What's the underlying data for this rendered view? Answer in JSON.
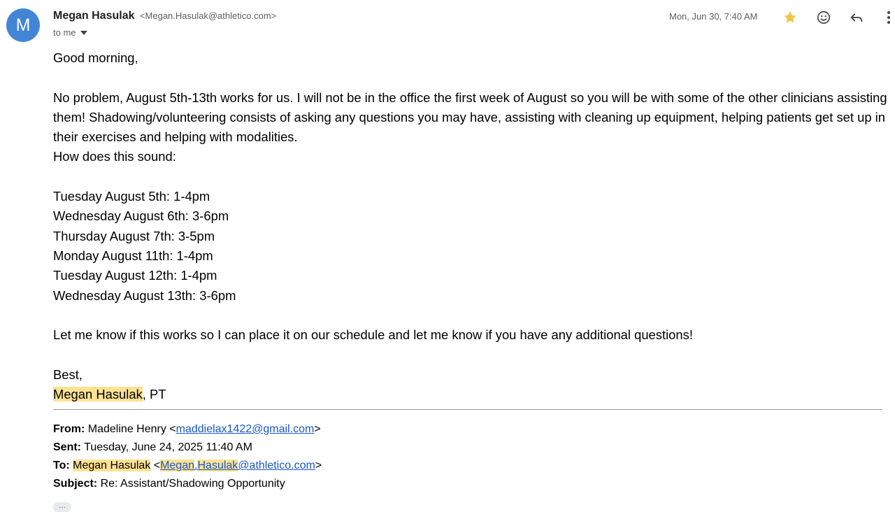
{
  "sender": {
    "initial": "M",
    "name": "Megan Hasulak",
    "email": "<Megan.Hasulak@athletico.com>",
    "to": "to me",
    "date": "Mon, Jun 30, 7:40 AM"
  },
  "header_icons": {
    "star": "star-icon",
    "emoji": "emoji-icon",
    "reply": "reply-icon",
    "more": "more-vertical-icon",
    "star_color": "#f6c343"
  },
  "body": {
    "greeting": "Good morning,",
    "para1": "No problem, August 5th-13th works for us. I will not be in the office the first week of August so you will be with some of the other clinicians assisting them! Shadowing/volunteering consists of asking any questions you may have, assisting with cleaning up equipment, helping patients get set up in their exercises and helping with modalities.",
    "question": "How does this sound:",
    "schedule": [
      "Tuesday August 5th: 1-4pm",
      "Wednesday August 6th: 3-6pm",
      "Thursday August 7th: 3-5pm",
      "Monday August 11th: 1-4pm",
      "Tuesday August 12th: 1-4pm",
      "Wednesday August 13th: 3-6pm"
    ],
    "closing": "Let me know if this works so I can place it on our schedule and let me know if you have any additional questions!",
    "signoff": "Best,",
    "signature_name": "Megan Hasulak",
    "signature_suffix": ", PT"
  },
  "quoted": {
    "from_label": "From:",
    "from_name": "Madeline Henry <",
    "from_email": "maddielax1422@gmail.com",
    "from_close": ">",
    "sent_label": "Sent:",
    "sent_value": "Tuesday, June 24, 2025 11:40 AM",
    "to_label": "To:",
    "to_name": "Megan Hasulak",
    "to_open": " <",
    "to_email_part1": "Megan",
    "to_email_dot": ".",
    "to_email_part2": "Hasulak",
    "to_email_domain": "@athletico.com",
    "to_close": ">",
    "subject_label": "Subject:",
    "subject_value": "Re: Assistant/Shadowing Opportunity"
  },
  "trimmed_content_label": "···",
  "colors": {
    "avatar": "#4285d6",
    "highlight": "#fde293",
    "link": "#1a57c6"
  }
}
